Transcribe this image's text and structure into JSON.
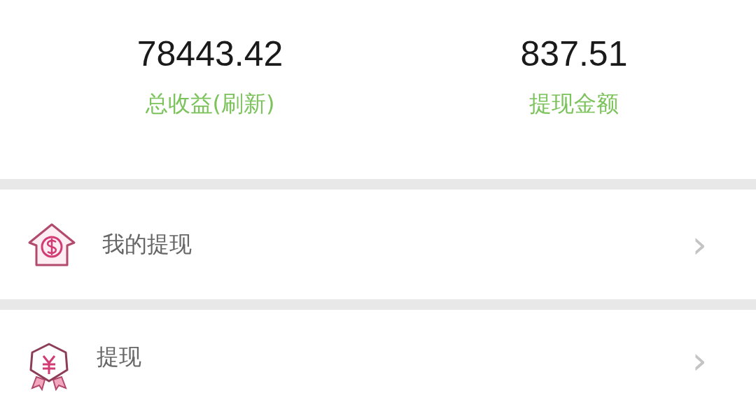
{
  "stats": [
    {
      "value": "78443.42",
      "label": "总收益(刷新)"
    },
    {
      "value": "837.51",
      "label": "提现金额"
    }
  ],
  "menu": [
    {
      "kind": "house",
      "label": "我的提现",
      "chevron": "›"
    },
    {
      "kind": "badge",
      "label": "提现",
      "chevron": "›"
    }
  ]
}
